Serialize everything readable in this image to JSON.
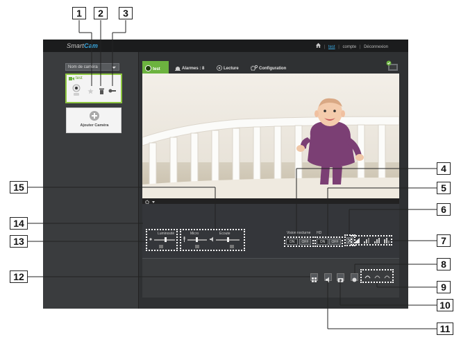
{
  "app": {
    "logo_part1": "Smart",
    "logo_part2": "Cam",
    "home_icon": "home-icon"
  },
  "top_nav": {
    "user": "test",
    "account": "compte",
    "logout": "Déconnexion",
    "separator": "|"
  },
  "sidebar": {
    "camera_select": {
      "value": "Nom de caméra"
    },
    "camera_card": {
      "name": "test",
      "icons": [
        "camera-thumbnail-icon",
        "star-icon",
        "trash-icon",
        "key-icon"
      ]
    },
    "add_camera": {
      "label": "Ajouter Caméra"
    }
  },
  "tabs": {
    "live": "test",
    "alarms": "Alarmes : 8",
    "playback": "Lecture",
    "config": "Configuration"
  },
  "controls": {
    "brightness_label": "Luminosité",
    "mic_label": "Micro",
    "speaker_label": "Ecoute",
    "night_mode_label": "Vision nocturne",
    "hd_label": "HD",
    "on": "ON",
    "off": "OFF",
    "sliders": {
      "brightness": 0.55,
      "mic": 0.45,
      "speaker": 0.5
    }
  },
  "callouts": [
    "1",
    "2",
    "3",
    "4",
    "5",
    "6",
    "7",
    "8",
    "9",
    "10",
    "11",
    "12",
    "13",
    "14",
    "15"
  ],
  "colors": {
    "accent_green": "#6cb33f",
    "link_blue": "#39a8e0",
    "dark_bg": "#2f3133"
  }
}
